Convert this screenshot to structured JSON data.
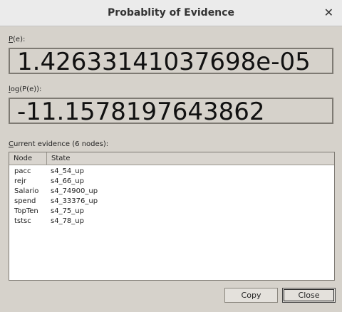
{
  "window": {
    "title": "Probablity of Evidence",
    "close_glyph": "✕"
  },
  "pe": {
    "label_mnemonic": "P",
    "label_rest": "(e):",
    "value": "1.42633141037698e-05"
  },
  "logpe": {
    "label_mnemonic": "l",
    "label_rest": "og(P(e)):",
    "value": "-11.1578197643862"
  },
  "evidence": {
    "label_mnemonic": "C",
    "label_rest": "urrent evidence (6 nodes):",
    "columns": [
      "Node",
      "State"
    ],
    "rows": [
      {
        "node": "pacc",
        "state": "s4_54_up"
      },
      {
        "node": "rejr",
        "state": "s4_66_up"
      },
      {
        "node": "Salario",
        "state": "s4_74900_up"
      },
      {
        "node": "spend",
        "state": "s4_33376_up"
      },
      {
        "node": "TopTen",
        "state": "s4_75_up"
      },
      {
        "node": "tstsc",
        "state": "s4_78_up"
      }
    ]
  },
  "buttons": {
    "copy": "Copy",
    "close": "Close"
  }
}
